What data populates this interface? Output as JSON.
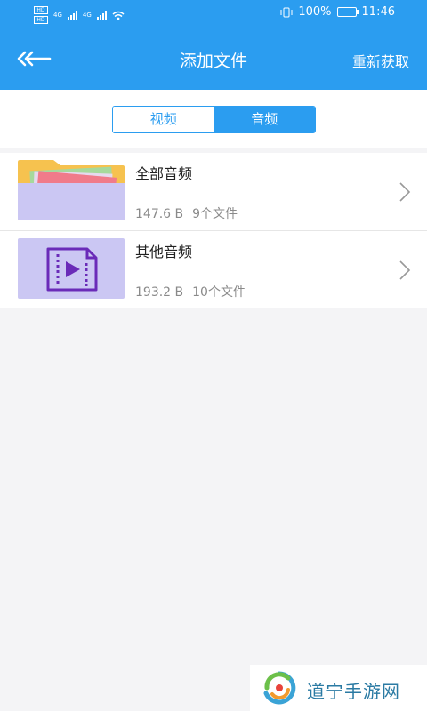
{
  "status_bar": {
    "battery": "100%",
    "time": "11:46",
    "hd_badge": "HD",
    "network": "4G"
  },
  "header": {
    "title": "添加文件",
    "action_label": "重新获取"
  },
  "tabs": {
    "video_label": "视频",
    "audio_label": "音频",
    "active": "音频"
  },
  "files": [
    {
      "name": "全部音频",
      "size": "147.6 B",
      "count": "9个文件"
    },
    {
      "name": "其他音频",
      "size": "193.2 B",
      "count": "10个文件"
    }
  ],
  "watermark": {
    "text": "道宁手游网"
  },
  "colors": {
    "primary": "#2b9df0",
    "background": "#f4f4f6",
    "thumb_bg": "#cbc7f3",
    "video_icon": "#6a2bb8"
  }
}
